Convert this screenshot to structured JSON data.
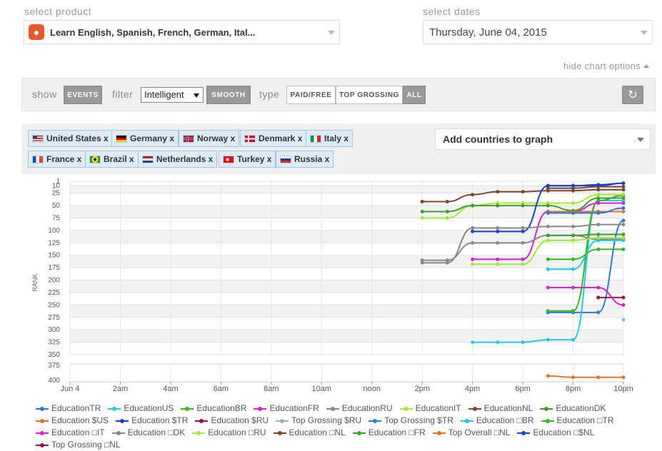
{
  "header": {
    "product_label": "select product",
    "product_name": "Learn English, Spanish, French, German, Ital...",
    "dates_label": "select dates",
    "date_value": "Thursday, June 04, 2015",
    "hide_options": "hide chart options"
  },
  "options": {
    "show_label": "show",
    "events_button": "EVENTS",
    "filter_label": "filter",
    "filter_value": "Intelligent",
    "smooth_button": "SMOOTH",
    "type_label": "type",
    "type_buttons": [
      "PAID/FREE",
      "TOP GROSSING",
      "ALL"
    ]
  },
  "countries": {
    "chips": [
      {
        "label": "United States x",
        "flag": "us"
      },
      {
        "label": "Germany x",
        "flag": "de"
      },
      {
        "label": "Norway x",
        "flag": "no"
      },
      {
        "label": "Denmark x",
        "flag": "dk"
      },
      {
        "label": "Italy x",
        "flag": "it"
      },
      {
        "label": "France x",
        "flag": "fr"
      },
      {
        "label": "Brazil x",
        "flag": "br"
      },
      {
        "label": "Netherlands x",
        "flag": "nl"
      },
      {
        "label": "Turkey x",
        "flag": "tr"
      },
      {
        "label": "Russia x",
        "flag": "ru"
      }
    ],
    "add_label": "Add countries to graph"
  },
  "chart_data": {
    "type": "line",
    "ylabel": "RANK",
    "y_ticks_main": [
      1,
      10,
      25,
      50,
      75,
      100,
      125,
      150,
      175,
      200,
      225,
      250,
      275,
      300,
      325,
      350
    ],
    "y_ticks_lower": [
      375,
      400
    ],
    "y_reversed": true,
    "x_ticks": [
      "Jun 4",
      "2am",
      "4am",
      "6am",
      "8am",
      "10am",
      "noon",
      "2pm",
      "4pm",
      "6pm",
      "8pm",
      "10pm"
    ],
    "x_range_hours": [
      0,
      22
    ],
    "grid": true,
    "series": [
      {
        "name": "Education TR",
        "color": "#2a7ad6",
        "x": [
          19,
          20,
          21,
          22
        ],
        "y": [
          265,
          265,
          265,
          80
        ]
      },
      {
        "name": "Education US",
        "color": "#22c8e8",
        "x": [
          16,
          17,
          18,
          19,
          20,
          21,
          22
        ],
        "y": [
          325,
          325,
          325,
          320,
          320,
          40,
          40
        ]
      },
      {
        "name": "Education BR",
        "color": "#39b51d",
        "x": [
          19,
          20,
          21,
          22
        ],
        "y": [
          262,
          262,
          40,
          30
        ]
      },
      {
        "name": "Education FR",
        "color": "#d61fd6",
        "x": [
          16,
          17,
          18,
          19,
          20,
          21,
          22
        ],
        "y": [
          158,
          158,
          158,
          62,
          62,
          45,
          45
        ]
      },
      {
        "name": "Education RU",
        "color": "#888888",
        "x": [
          14,
          15,
          16,
          17,
          18,
          19,
          20,
          21,
          22
        ],
        "y": [
          160,
          160,
          125,
          125,
          125,
          110,
          110,
          118,
          118
        ]
      },
      {
        "name": "Education IT",
        "color": "#a6e636",
        "x": [
          14,
          15,
          16,
          17,
          18,
          19,
          20,
          21,
          22
        ],
        "y": [
          75,
          75,
          50,
          45,
          45,
          45,
          45,
          28,
          28
        ]
      },
      {
        "name": "Education NL",
        "color": "#7b4a2e",
        "x": [
          14,
          15,
          16,
          17,
          18,
          19,
          20,
          21,
          22
        ],
        "y": [
          42,
          42,
          28,
          22,
          22,
          20,
          20,
          18,
          18
        ]
      },
      {
        "name": "Education DK",
        "color": "#3aa02a",
        "x": [
          14,
          15,
          16,
          17,
          18,
          19,
          20,
          21,
          22
        ],
        "y": [
          62,
          62,
          50,
          50,
          50,
          50,
          60,
          35,
          35
        ]
      },
      {
        "name": "Education $US",
        "color": "#e8702a",
        "x": [
          19,
          20,
          21,
          22
        ],
        "y": [
          62,
          62,
          62,
          62
        ]
      },
      {
        "name": "Education $TR",
        "color": "#1a3fd6",
        "x": [
          16,
          17,
          18,
          19,
          20,
          21,
          22
        ],
        "y": [
          102,
          102,
          102,
          10,
          10,
          10,
          5
        ]
      },
      {
        "name": "Education $RU",
        "color": "#a0103a",
        "x": [
          21,
          22
        ],
        "y": [
          235,
          235
        ]
      },
      {
        "name": "Top Grossing $RU",
        "color": "#9ab0be",
        "x": [
          22
        ],
        "y": [
          280
        ]
      },
      {
        "name": "Top Grossing $TR",
        "color": "#2a7ad6",
        "x": [
          19,
          20,
          21,
          22
        ],
        "y": [
          65,
          65,
          65,
          55
        ]
      },
      {
        "name": "Education BR (iPad)",
        "color": "#22c8e8",
        "x": [
          19,
          20,
          21,
          22
        ],
        "y": [
          178,
          178,
          120,
          120
        ]
      },
      {
        "name": "Education TR (iPad)",
        "color": "#39b51d",
        "x": [
          19,
          20,
          21,
          22
        ],
        "y": [
          158,
          158,
          138,
          138
        ]
      },
      {
        "name": "Education IT (iPad)",
        "color": "#d61fd6",
        "x": [
          19,
          20,
          21,
          22
        ],
        "y": [
          215,
          215,
          215,
          250
        ]
      },
      {
        "name": "Education DK (iPad)",
        "color": "#888888",
        "x": [
          14,
          15,
          16,
          17,
          18,
          19,
          20,
          21,
          22
        ],
        "y": [
          165,
          165,
          95,
          95,
          95,
          92,
          92,
          88,
          88
        ]
      },
      {
        "name": "Education RU (iPad)",
        "color": "#a6e636",
        "x": [
          16,
          17,
          18,
          19,
          20,
          21,
          22
        ],
        "y": [
          168,
          168,
          168,
          120,
          120,
          115,
          115
        ]
      },
      {
        "name": "Education NL (iPad)",
        "color": "#7b4a2e",
        "x": [
          19,
          20,
          21,
          22
        ],
        "y": [
          15,
          15,
          12,
          12
        ]
      },
      {
        "name": "Education FR (iPad)",
        "color": "#3aa02a",
        "x": [
          19,
          20,
          21,
          22
        ],
        "y": [
          110,
          110,
          108,
          108
        ]
      },
      {
        "name": "Top Overall NL (iPad)",
        "color": "#e8702a",
        "x": [
          19,
          20,
          21,
          22
        ],
        "y": [
          385,
          390,
          390,
          390
        ]
      },
      {
        "name": "Education $NL (iPad)",
        "color": "#1a3fd6",
        "x": [
          19,
          20,
          21,
          22
        ],
        "y": [
          10,
          10,
          8,
          5
        ]
      }
    ],
    "legend": {
      "placement": "bottom",
      "entries": [
        {
          "label": "EducationTR",
          "color": "#2a7ad6"
        },
        {
          "label": "EducationUS",
          "color": "#22c8e8"
        },
        {
          "label": "EducationBR",
          "color": "#39b51d"
        },
        {
          "label": "EducationFR",
          "color": "#d61fd6"
        },
        {
          "label": "EducationRU",
          "color": "#888888"
        },
        {
          "label": "EducationIT",
          "color": "#a6e636"
        },
        {
          "label": "EducationNL",
          "color": "#7b4a2e"
        },
        {
          "label": "EducationDK",
          "color": "#3aa02a"
        },
        {
          "label": "Education $US",
          "color": "#e8702a"
        },
        {
          "label": "Education $TR",
          "color": "#1a3fd6"
        },
        {
          "label": "Education $RU",
          "color": "#a0103a"
        },
        {
          "label": "Top Grossing $RU",
          "color": "#9ab0be"
        },
        {
          "label": "Top Grossing $TR",
          "color": "#2a7ad6"
        },
        {
          "label": "Education □BR",
          "color": "#22c8e8"
        },
        {
          "label": "Education □TR",
          "color": "#39b51d"
        },
        {
          "label": "Education □IT",
          "color": "#d61fd6"
        },
        {
          "label": "Education □DK",
          "color": "#888888"
        },
        {
          "label": "Education □RU",
          "color": "#a6e636"
        },
        {
          "label": "Education □NL",
          "color": "#7b4a2e"
        },
        {
          "label": "Education □FR",
          "color": "#3aa02a"
        },
        {
          "label": "Top Overall □NL",
          "color": "#e8702a"
        },
        {
          "label": "Education □$NL",
          "color": "#1a3fd6"
        },
        {
          "label": "Top Grossing □NL",
          "color": "#a0103a"
        }
      ]
    }
  }
}
